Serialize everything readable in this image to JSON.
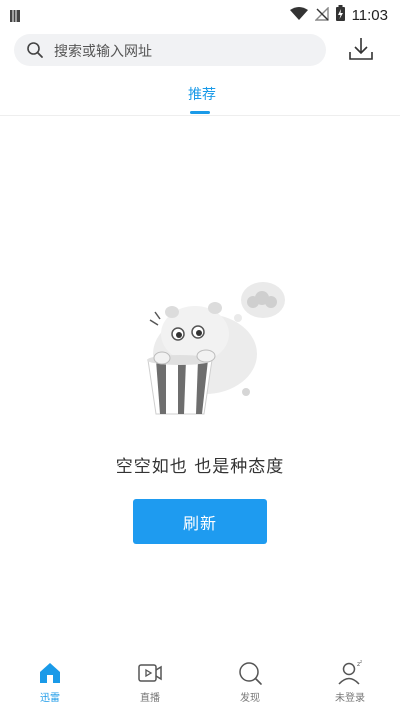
{
  "status_bar": {
    "time": "11:03"
  },
  "search": {
    "placeholder": "搜索或输入网址"
  },
  "tabs": [
    {
      "label": "推荐",
      "active": true
    }
  ],
  "empty_state": {
    "message": "空空如也 也是种态度",
    "refresh_label": "刷新"
  },
  "bottom_nav": [
    {
      "label": "迅雷",
      "icon": "home-icon",
      "active": true
    },
    {
      "label": "直播",
      "icon": "video-camera-icon",
      "active": false
    },
    {
      "label": "发现",
      "icon": "discover-icon",
      "active": false
    },
    {
      "label": "未登录",
      "icon": "user-icon",
      "active": false
    }
  ],
  "colors": {
    "accent": "#1a9ae8",
    "button": "#1e9bf0",
    "search_bg": "#f1f2f4"
  }
}
